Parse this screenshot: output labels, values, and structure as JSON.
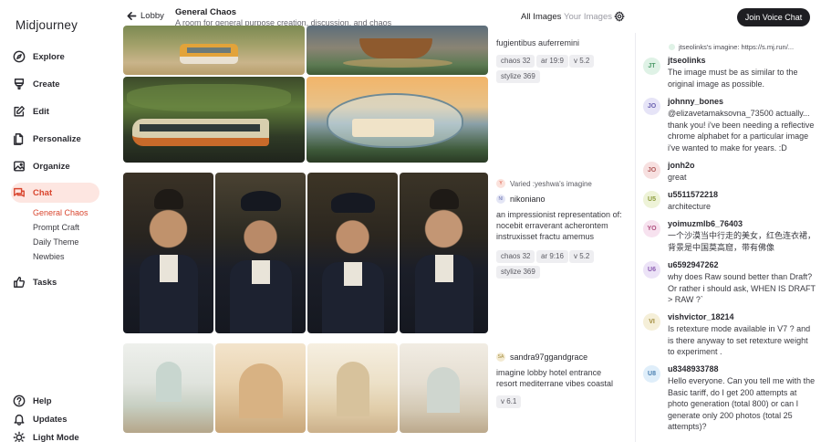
{
  "app": {
    "logo": "Midjourney"
  },
  "sidebar": {
    "items": [
      {
        "label": "Explore",
        "icon": "compass-icon"
      },
      {
        "label": "Create",
        "icon": "brush-icon"
      },
      {
        "label": "Edit",
        "icon": "edit-icon"
      },
      {
        "label": "Personalize",
        "icon": "personalize-icon"
      },
      {
        "label": "Organize",
        "icon": "image-icon"
      },
      {
        "label": "Chat",
        "icon": "chat-icon"
      },
      {
        "label": "Tasks",
        "icon": "thumbs-up-icon"
      }
    ],
    "chat_rooms": [
      "General Chaos",
      "Prompt Craft",
      "Daily Theme",
      "Newbies"
    ],
    "bottom": [
      {
        "label": "Help",
        "icon": "help-icon"
      },
      {
        "label": "Updates",
        "icon": "bell-icon"
      },
      {
        "label": "Light Mode",
        "icon": "sun-icon"
      }
    ]
  },
  "header": {
    "back_label": "Lobby",
    "room_title": "General Chaos",
    "room_subtitle": "A room for general purpose creation, discussion, and chaos",
    "tab_all": "All Images",
    "tab_yours": "Your Images",
    "voice_button": "Join Voice Chat"
  },
  "feed": {
    "post1": {
      "prompt": "fugientibus auferremini",
      "tags": [
        "chaos 32",
        "ar 19:9",
        "v 5.2",
        "stylize 369"
      ]
    },
    "post2": {
      "varied_note": "Varied :yeshwa's imagine",
      "user": "nikoniano",
      "prompt": "an impressionist representation of: nocebit erraverant acherontem instruxisset fractu amemus",
      "tags": [
        "chaos 32",
        "ar 9:16",
        "v 5.2",
        "stylize 369"
      ]
    },
    "post3": {
      "user": "sandra97ggandgrace",
      "prompt": "imagine lobby hotel entrance resort mediterrane vibes coastal",
      "tags": [
        "v 6.1"
      ]
    }
  },
  "chat": {
    "reply_preview": "jtseolinks's imagine: https://s.mj.run/...",
    "messages": [
      {
        "initials": "JT",
        "user": "jtseolinks",
        "text": "The image must be as similar to the original image as possible.",
        "color": "#dff2e6",
        "fg": "#4d9a6a"
      },
      {
        "initials": "JO",
        "user": "johnny_bones",
        "text": "@elizavetamaksovna_73500 actually... thank you! i've been needing a reflective chrome alphabet for a particular image i've wanted to make for years. :D",
        "color": "#e6e4f7",
        "fg": "#6b62b0"
      },
      {
        "initials": "JO",
        "user": "jonh2o",
        "text": "great",
        "color": "#f7e0e0",
        "fg": "#b05a5a"
      },
      {
        "initials": "U5",
        "user": "u5511572218",
        "text": "architecture",
        "color": "#eef3d8",
        "fg": "#8a9a3a"
      },
      {
        "initials": "YO",
        "user": "yoimuzmlb6_76403",
        "text": "一个沙漠当中行走的美女，红色连衣裙，背景是中国莫高窟，带有佛像",
        "color": "#f7e2ef",
        "fg": "#b0507f"
      },
      {
        "initials": "U6",
        "user": "u6592947262",
        "text": "why does Raw sound better than Draft? Or rather i should ask, WHEN IS DRAFT > RAW ?`",
        "color": "#ece3f7",
        "fg": "#8a5ab0"
      },
      {
        "initials": "VI",
        "user": "vishvictor_18214",
        "text": "Is retexture mode available in V7 ? and is there anyway to set retexture weight to experiment .",
        "color": "#f5efd8",
        "fg": "#a08a3a"
      },
      {
        "initials": "U8",
        "user": "u8348933788",
        "text": "Hello everyone. Can you tell me with the Basic tariff, do I get 200 attempts at photo generation (total 800) or can I generate only 200 photos (total 25 attempts)?",
        "color": "#dfeefa",
        "fg": "#4a7fb0"
      }
    ]
  }
}
